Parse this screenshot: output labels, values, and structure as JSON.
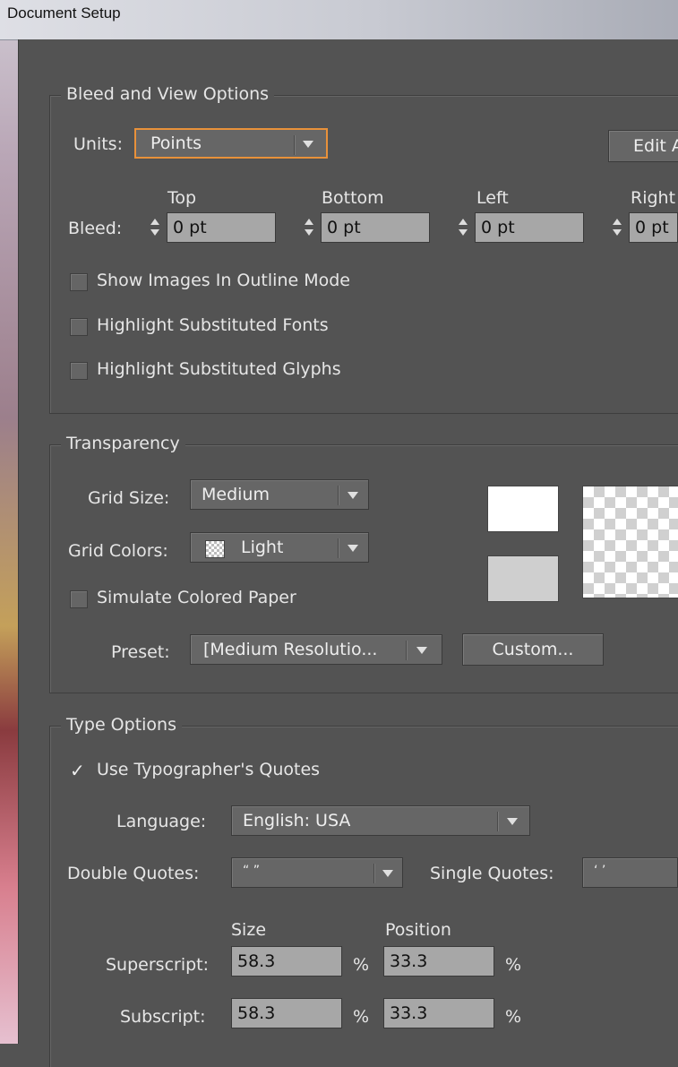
{
  "window": {
    "title": "Document Setup"
  },
  "bleed_view": {
    "group_title": "Bleed and View Options",
    "units_label": "Units:",
    "units_value": "Points",
    "edit_button": "Edit A",
    "bleed_label": "Bleed:",
    "columns": [
      "Top",
      "Bottom",
      "Left",
      "Right"
    ],
    "values": [
      "0 pt",
      "0 pt",
      "0 pt",
      "0 pt"
    ],
    "checkboxes": [
      {
        "label": "Show Images In Outline Mode",
        "checked": false
      },
      {
        "label": "Highlight Substituted Fonts",
        "checked": false
      },
      {
        "label": "Highlight Substituted Glyphs",
        "checked": false
      }
    ]
  },
  "transparency": {
    "group_title": "Transparency",
    "grid_size_label": "Grid Size:",
    "grid_size_value": "Medium",
    "grid_colors_label": "Grid Colors:",
    "grid_colors_value": "Light",
    "simulate_paper_label": "Simulate Colored Paper",
    "preset_label": "Preset:",
    "preset_value": "[Medium Resolutio...",
    "custom_button": "Custom...",
    "colors": {
      "swatch1": "#ffffff",
      "swatch2": "#cfcfcf"
    }
  },
  "type_options": {
    "group_title": "Type Options",
    "typographers_quotes_label": "Use Typographer's Quotes",
    "typographers_quotes_checked": true,
    "language_label": "Language:",
    "language_value": "English: USA",
    "double_quotes_label": "Double Quotes:",
    "double_quotes_value": "“ ”",
    "single_quotes_label": "Single Quotes:",
    "single_quotes_value": "‘ ’",
    "size_header": "Size",
    "position_header": "Position",
    "superscript_label": "Superscript:",
    "superscript_size": "58.3",
    "superscript_position": "33.3",
    "subscript_label": "Subscript:",
    "subscript_size": "58.3",
    "subscript_position": "33.3",
    "percent": "%"
  },
  "theme": {
    "bg": "#535353",
    "focus": "#e8913a"
  }
}
